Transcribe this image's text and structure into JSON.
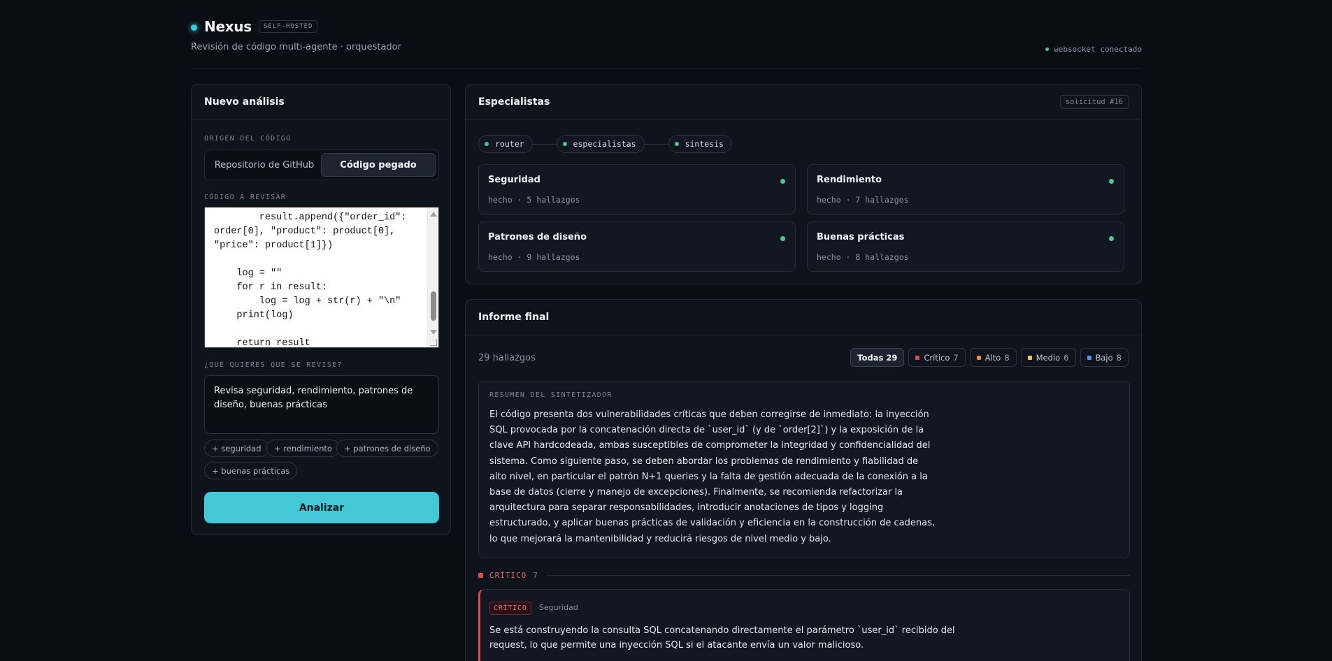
{
  "header": {
    "app_name": "Nexus",
    "tag": "SELF-HOSTED",
    "subtitle": "Revisión de código multi-agente · orquestador",
    "ws_status": "websocket conectado"
  },
  "new_analysis": {
    "title": "Nuevo análisis",
    "source_label": "ORIGEN DEL CÓDIGO",
    "source_options": [
      "Repositorio de GitHub",
      "Código pegado"
    ],
    "source_selected": "Código pegado",
    "code_label": "CÓDIGO A REVISAR",
    "code_value": "        result.append({\"order_id\":\norder[0], \"product\": product[0],\n\"price\": product[1]})\n\n    log = \"\"\n    for r in result:\n        log = log + str(r) + \"\\n\"\n    print(log)\n\n    return result",
    "request_label": "¿QUÉ QUIERES QUE SE REVISE?",
    "request_value": "Revisa seguridad, rendimiento, patrones de diseño, buenas prácticas",
    "chips": [
      "+ seguridad",
      "+ rendimiento",
      "+ patrones de diseño",
      "+ buenas prácticas"
    ],
    "analyze_label": "Analizar"
  },
  "specialists": {
    "title": "Especialistas",
    "request_tag": "solicitud #16",
    "pipeline": [
      "router",
      "especialistas",
      "síntesis"
    ],
    "cards": [
      {
        "name": "Seguridad",
        "status": "hecho · 5 hallazgos"
      },
      {
        "name": "Rendimiento",
        "status": "hecho · 7 hallazgos"
      },
      {
        "name": "Patrones de diseño",
        "status": "hecho · 9 hallazgos"
      },
      {
        "name": "Buenas prácticas",
        "status": "hecho · 8 hallazgos"
      }
    ],
    "status_color": "#4fc98a"
  },
  "report": {
    "title": "Informe final",
    "count": "29 hallazgos",
    "filters": [
      {
        "label": "Todas",
        "count": "29"
      },
      {
        "label": "Crítico",
        "count": "7",
        "color": "#e5484d"
      },
      {
        "label": "Alto",
        "count": "8",
        "color": "#f08a3e"
      },
      {
        "label": "Medio",
        "count": "6",
        "color": "#f2c14e"
      },
      {
        "label": "Bajo",
        "count": "8",
        "color": "#5b8def"
      }
    ],
    "summary_label": "RESUMEN DEL SINTETIZADOR",
    "summary_text": "El código presenta dos vulnerabilidades críticas que deben corregirse de inmediato: la inyección SQL provocada por la concatenación directa de `user_id` (y de `order[2]`) y la exposición de la clave API hardcodeada, ambas susceptibles de comprometer la integridad y confidencialidad del sistema. Como siguiente paso, se deben abordar los problemas de rendimiento y fiabilidad de alto nivel, en particular el patrón N+1 queries y la falta de gestión adecuada de la conexión a la base de datos (cierre y manejo de excepciones). Finalmente, se recomienda refactorizar la arquitectura para separar responsabilidades, introducir anotaciones de tipos y logging estructurado, y aplicar buenas prácticas de validación y eficiencia en la construcción de cadenas, lo que mejorará la mantenibilidad y reducirá riesgos de nivel medio y bajo.",
    "severity_group": {
      "label": "CRÍTICO",
      "count": "7"
    },
    "finding": {
      "badge": "CRÍTICO",
      "category": "Seguridad",
      "text": "Se está construyendo la consulta SQL concatenando directamente el parámetro `user_id` recibido del request, lo que permite una inyección SQL si el atacante envía un valor malicioso."
    }
  },
  "colors": {
    "accent": "#45c8d6",
    "critical": "#e5484d",
    "ok": "#4fc98a"
  }
}
